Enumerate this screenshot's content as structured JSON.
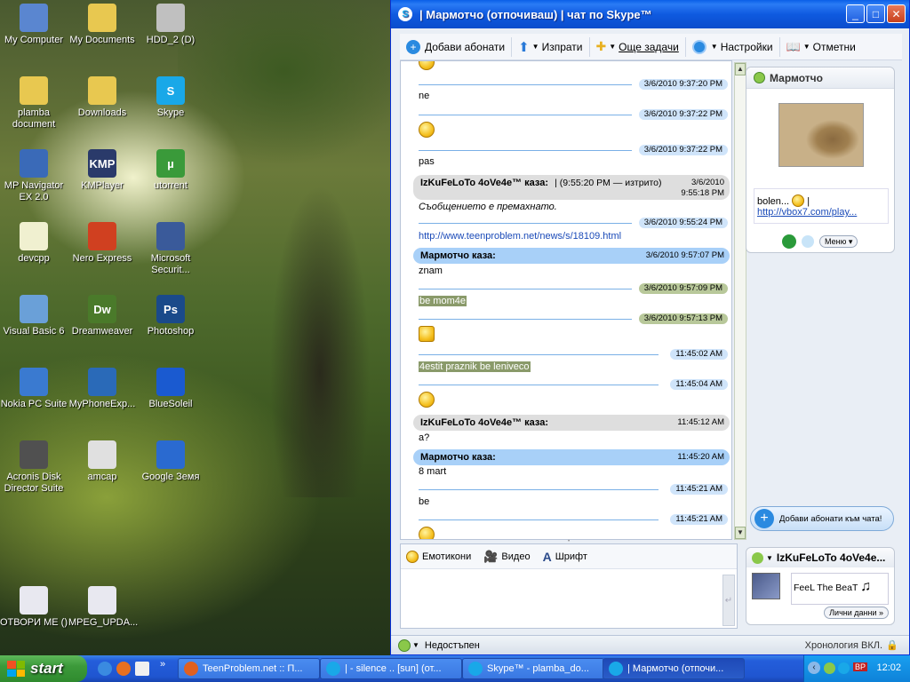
{
  "desktop": {
    "icons": [
      {
        "label": "My Computer",
        "color": "#5a86d0"
      },
      {
        "label": "My Documents",
        "color": "#e8c850"
      },
      {
        "label": "HDD_2 (D)",
        "color": "#c0c0c0"
      },
      {
        "label": "plamba document",
        "color": "#e8c850"
      },
      {
        "label": "Downloads",
        "color": "#e8c850"
      },
      {
        "label": "Skype",
        "color": "#19a8e8"
      },
      {
        "label": "MP Navigator EX 2.0",
        "color": "#3a6ab8"
      },
      {
        "label": "KMPlayer",
        "color": "#2a3a6a"
      },
      {
        "label": "utorrent",
        "color": "#3a9a3a"
      },
      {
        "label": "devcpp",
        "color": "#f0f0d0"
      },
      {
        "label": "Nero Express",
        "color": "#d04020"
      },
      {
        "label": "Microsoft Securit...",
        "color": "#3a5a9a"
      },
      {
        "label": "Visual Basic 6",
        "color": "#6aa0d8"
      },
      {
        "label": "Dreamweaver",
        "color": "#4a7a2a"
      },
      {
        "label": "Photoshop",
        "color": "#1a4a8a"
      },
      {
        "label": "Nokia PC Suite",
        "color": "#3a7ad0"
      },
      {
        "label": "MyPhoneExp...",
        "color": "#2a6ab8"
      },
      {
        "label": "BlueSoleil",
        "color": "#1a5ad0"
      },
      {
        "label": "Acronis Disk Director Suite",
        "color": "#505050"
      },
      {
        "label": "amcap",
        "color": "#e0e0e0"
      },
      {
        "label": "Google Земя",
        "color": "#2a6ad0"
      },
      {
        "label": "ОТВОРИ МЕ ()",
        "color": "#e8e8f0"
      },
      {
        "label": "MPEG_UPDA...",
        "color": "#e8e8f0"
      }
    ],
    "icon_glyphs": [
      "",
      "",
      "",
      "",
      "",
      "S",
      "",
      "KMP",
      "µ",
      "",
      "",
      "",
      "",
      "Dw",
      "Ps",
      "",
      "",
      "",
      "",
      "",
      "",
      "",
      ""
    ]
  },
  "window": {
    "title": "| Мармотчо (отпочиваш) | чат по Skype™",
    "toolbar": {
      "add": "Добави абонати",
      "send": "Изпрати",
      "tasks": "Още задачи",
      "settings": "Настройки",
      "bookmarks": "Отметни"
    },
    "messages": {
      "ts1": "3/6/2010 9:37:20 PM",
      "m1": "ne",
      "ts2": "3/6/2010 9:37:22 PM",
      "ts3": "3/6/2010 9:37:22 PM",
      "m3": "pas",
      "s1_name": "IzKuFeLoTo 4oVe4e™ каза:",
      "s1_edit": "| (9:55:20 PM — изтрито)",
      "s1_date": "3/6/2010",
      "s1_time": "9:55:18 PM",
      "deleted": "Съобщението е премахнато.",
      "ts4": "3/6/2010 9:55:24 PM",
      "link": "http://www.teenproblem.net/news/s/18109.html",
      "s2_name": "Мармотчо каза:",
      "s2_time": "3/6/2010 9:57:07 PM",
      "m5": "znam",
      "ts5": "3/6/2010 9:57:09 PM",
      "m6": "be mom4e",
      "ts6": "3/6/2010 9:57:13 PM",
      "ts7": "11:45:02 AM",
      "m8": "4estit praznik be leniveco",
      "ts8": "11:45:04 AM",
      "s3_name": "IzKuFeLoTo 4oVe4e™ каза:",
      "s3_time": "11:45:12 AM",
      "m9": "a?",
      "s4_name": "Мармотчо каза:",
      "s4_time": "11:45:20 AM",
      "m10": "8 mart",
      "ts9": "11:45:21 AM",
      "m11": "be",
      "ts10": "11:45:21 AM"
    },
    "compose": {
      "emoticons": "Емотикони",
      "video": "Видео",
      "font": "Шрифт"
    },
    "status": {
      "label": "Недостъпен",
      "history": "Хронология ВКЛ."
    },
    "contact": {
      "name": "Мармотчо",
      "mood_text": "bolen...",
      "mood_bar": "|",
      "mood_link": "http://vbox7.com/play...",
      "menu": "Меню"
    },
    "add_to_chat": "Добави абонати към чата!",
    "me": {
      "name": "IzKuFeLoTo 4oVe4e...",
      "mood": "FeeL The BeaT",
      "profile": "Лични данни »"
    }
  },
  "taskbar": {
    "start": "start",
    "tasks": [
      {
        "label": "TeenProblem.net :: П...",
        "color": "#e06020"
      },
      {
        "label": "| - silence .. [sun] (от...",
        "color": "#19a8e8"
      },
      {
        "label": "Skype™ - plamba_do...",
        "color": "#19a8e8"
      },
      {
        "label": "| Мармотчо (отпочи...",
        "color": "#19a8e8"
      }
    ],
    "lang": "BP",
    "clock": "12:02"
  }
}
